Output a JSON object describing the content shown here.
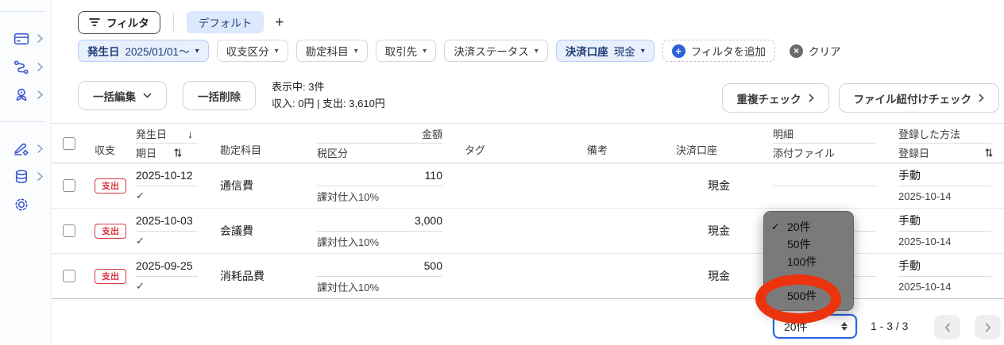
{
  "icons": {
    "caret_down": "▾",
    "check": "✓",
    "plus": "+",
    "cross": "×",
    "arrow_down": "↓"
  },
  "toolbar": {
    "filter_button": "フィルタ",
    "preset_tab": "デフォルト",
    "add_tab": "+"
  },
  "filters": {
    "chips": [
      {
        "label": "発生日",
        "value": "2025/01/01〜"
      },
      {
        "label": "収支区分",
        "value": ""
      },
      {
        "label": "勘定科目",
        "value": ""
      },
      {
        "label": "取引先",
        "value": ""
      },
      {
        "label": "決済ステータス",
        "value": ""
      },
      {
        "label": "決済口座",
        "value": "現金"
      }
    ],
    "add_filter_label": "フィルタを追加",
    "clear_label": "クリア"
  },
  "actions": {
    "bulk_edit": "一括編集",
    "bulk_delete": "一括削除",
    "showing": "表示中: 3件",
    "totals": "収入: 0円 | 支出: 3,610円",
    "duplicate_check": "重複チェック",
    "file_link_check": "ファイル紐付けチェック"
  },
  "table": {
    "headers": {
      "type": "収支",
      "occur_date": "発生日",
      "due_date": "期日",
      "account": "勘定科目",
      "amount": "金額",
      "tax": "税区分",
      "tag": "タグ",
      "memo": "備考",
      "wallet": "決済口座",
      "detail": "明細",
      "attachment": "添付ファイル",
      "method": "登録した方法",
      "registered": "登録日"
    },
    "rows": [
      {
        "type": "支出",
        "date": "2025-10-12",
        "account": "通信費",
        "amount": "110",
        "tax": "課対仕入10%",
        "wallet": "現金",
        "method": "手動",
        "registered": "2025-10-14"
      },
      {
        "type": "支出",
        "date": "2025-10-03",
        "account": "会議費",
        "amount": "3,000",
        "tax": "課対仕入10%",
        "wallet": "現金",
        "method": "手動",
        "registered": "2025-10-14"
      },
      {
        "type": "支出",
        "date": "2025-09-25",
        "account": "消耗品費",
        "amount": "500",
        "tax": "課対仕入10%",
        "wallet": "現金",
        "method": "手動",
        "registered": "2025-10-14"
      }
    ]
  },
  "page_size_menu": {
    "options": [
      "20件",
      "50件",
      "100件",
      "500件"
    ],
    "selected": "20件",
    "highlighted": "500件"
  },
  "pagination": {
    "page_size": "20件",
    "range": "1 - 3 / 3"
  },
  "colors": {
    "accent_blue": "#2e62d9",
    "badge_red": "#d7373f",
    "annotation_red": "#eb340e",
    "menu_gray": "#767676"
  }
}
